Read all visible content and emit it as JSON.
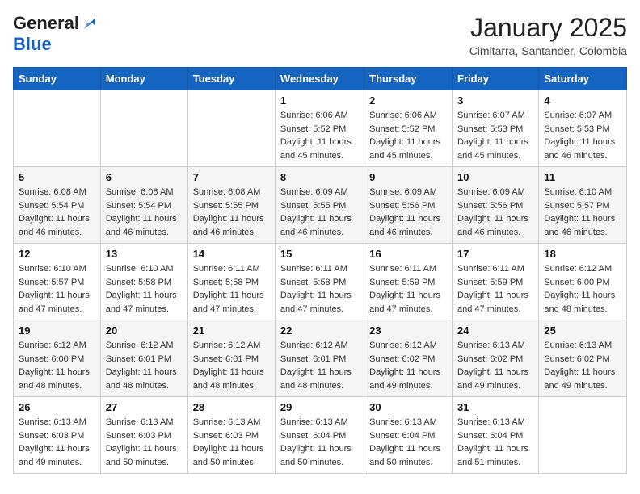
{
  "header": {
    "logo": {
      "general": "General",
      "blue": "Blue",
      "tagline": ""
    },
    "title": "January 2025",
    "location": "Cimitarra, Santander, Colombia"
  },
  "calendar": {
    "weekdays": [
      "Sunday",
      "Monday",
      "Tuesday",
      "Wednesday",
      "Thursday",
      "Friday",
      "Saturday"
    ],
    "weeks": [
      [
        {
          "day": "",
          "info": ""
        },
        {
          "day": "",
          "info": ""
        },
        {
          "day": "",
          "info": ""
        },
        {
          "day": "1",
          "info": "Sunrise: 6:06 AM\nSunset: 5:52 PM\nDaylight: 11 hours\nand 45 minutes."
        },
        {
          "day": "2",
          "info": "Sunrise: 6:06 AM\nSunset: 5:52 PM\nDaylight: 11 hours\nand 45 minutes."
        },
        {
          "day": "3",
          "info": "Sunrise: 6:07 AM\nSunset: 5:53 PM\nDaylight: 11 hours\nand 45 minutes."
        },
        {
          "day": "4",
          "info": "Sunrise: 6:07 AM\nSunset: 5:53 PM\nDaylight: 11 hours\nand 46 minutes."
        }
      ],
      [
        {
          "day": "5",
          "info": "Sunrise: 6:08 AM\nSunset: 5:54 PM\nDaylight: 11 hours\nand 46 minutes."
        },
        {
          "day": "6",
          "info": "Sunrise: 6:08 AM\nSunset: 5:54 PM\nDaylight: 11 hours\nand 46 minutes."
        },
        {
          "day": "7",
          "info": "Sunrise: 6:08 AM\nSunset: 5:55 PM\nDaylight: 11 hours\nand 46 minutes."
        },
        {
          "day": "8",
          "info": "Sunrise: 6:09 AM\nSunset: 5:55 PM\nDaylight: 11 hours\nand 46 minutes."
        },
        {
          "day": "9",
          "info": "Sunrise: 6:09 AM\nSunset: 5:56 PM\nDaylight: 11 hours\nand 46 minutes."
        },
        {
          "day": "10",
          "info": "Sunrise: 6:09 AM\nSunset: 5:56 PM\nDaylight: 11 hours\nand 46 minutes."
        },
        {
          "day": "11",
          "info": "Sunrise: 6:10 AM\nSunset: 5:57 PM\nDaylight: 11 hours\nand 46 minutes."
        }
      ],
      [
        {
          "day": "12",
          "info": "Sunrise: 6:10 AM\nSunset: 5:57 PM\nDaylight: 11 hours\nand 47 minutes."
        },
        {
          "day": "13",
          "info": "Sunrise: 6:10 AM\nSunset: 5:58 PM\nDaylight: 11 hours\nand 47 minutes."
        },
        {
          "day": "14",
          "info": "Sunrise: 6:11 AM\nSunset: 5:58 PM\nDaylight: 11 hours\nand 47 minutes."
        },
        {
          "day": "15",
          "info": "Sunrise: 6:11 AM\nSunset: 5:58 PM\nDaylight: 11 hours\nand 47 minutes."
        },
        {
          "day": "16",
          "info": "Sunrise: 6:11 AM\nSunset: 5:59 PM\nDaylight: 11 hours\nand 47 minutes."
        },
        {
          "day": "17",
          "info": "Sunrise: 6:11 AM\nSunset: 5:59 PM\nDaylight: 11 hours\nand 47 minutes."
        },
        {
          "day": "18",
          "info": "Sunrise: 6:12 AM\nSunset: 6:00 PM\nDaylight: 11 hours\nand 48 minutes."
        }
      ],
      [
        {
          "day": "19",
          "info": "Sunrise: 6:12 AM\nSunset: 6:00 PM\nDaylight: 11 hours\nand 48 minutes."
        },
        {
          "day": "20",
          "info": "Sunrise: 6:12 AM\nSunset: 6:01 PM\nDaylight: 11 hours\nand 48 minutes."
        },
        {
          "day": "21",
          "info": "Sunrise: 6:12 AM\nSunset: 6:01 PM\nDaylight: 11 hours\nand 48 minutes."
        },
        {
          "day": "22",
          "info": "Sunrise: 6:12 AM\nSunset: 6:01 PM\nDaylight: 11 hours\nand 48 minutes."
        },
        {
          "day": "23",
          "info": "Sunrise: 6:12 AM\nSunset: 6:02 PM\nDaylight: 11 hours\nand 49 minutes."
        },
        {
          "day": "24",
          "info": "Sunrise: 6:13 AM\nSunset: 6:02 PM\nDaylight: 11 hours\nand 49 minutes."
        },
        {
          "day": "25",
          "info": "Sunrise: 6:13 AM\nSunset: 6:02 PM\nDaylight: 11 hours\nand 49 minutes."
        }
      ],
      [
        {
          "day": "26",
          "info": "Sunrise: 6:13 AM\nSunset: 6:03 PM\nDaylight: 11 hours\nand 49 minutes."
        },
        {
          "day": "27",
          "info": "Sunrise: 6:13 AM\nSunset: 6:03 PM\nDaylight: 11 hours\nand 50 minutes."
        },
        {
          "day": "28",
          "info": "Sunrise: 6:13 AM\nSunset: 6:03 PM\nDaylight: 11 hours\nand 50 minutes."
        },
        {
          "day": "29",
          "info": "Sunrise: 6:13 AM\nSunset: 6:04 PM\nDaylight: 11 hours\nand 50 minutes."
        },
        {
          "day": "30",
          "info": "Sunrise: 6:13 AM\nSunset: 6:04 PM\nDaylight: 11 hours\nand 50 minutes."
        },
        {
          "day": "31",
          "info": "Sunrise: 6:13 AM\nSunset: 6:04 PM\nDaylight: 11 hours\nand 51 minutes."
        },
        {
          "day": "",
          "info": ""
        }
      ]
    ]
  }
}
